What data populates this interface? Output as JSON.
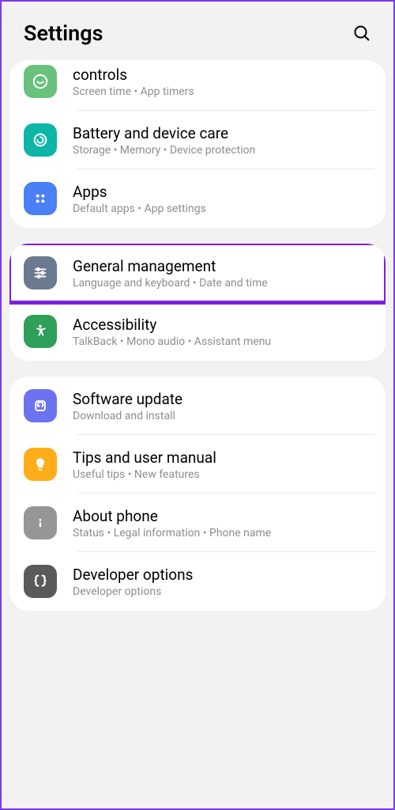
{
  "header": {
    "title": "Settings"
  },
  "sections": [
    {
      "items": [
        {
          "title": "controls",
          "subtitle": "Screen time  •  App timers"
        },
        {
          "title": "Battery and device care",
          "subtitle": "Storage  •  Memory  •  Device protection"
        },
        {
          "title": "Apps",
          "subtitle": "Default apps  •  App settings"
        }
      ]
    },
    {
      "items": [
        {
          "title": "General management",
          "subtitle": "Language and keyboard  •  Date and time"
        },
        {
          "title": "Accessibility",
          "subtitle": "TalkBack  •  Mono audio  •  Assistant menu"
        }
      ]
    },
    {
      "items": [
        {
          "title": "Software update",
          "subtitle": "Download and install"
        },
        {
          "title": "Tips and user manual",
          "subtitle": "Useful tips  •  New features"
        },
        {
          "title": "About phone",
          "subtitle": "Status  •  Legal information  •  Phone name"
        },
        {
          "title": "Developer options",
          "subtitle": "Developer options"
        }
      ]
    }
  ]
}
